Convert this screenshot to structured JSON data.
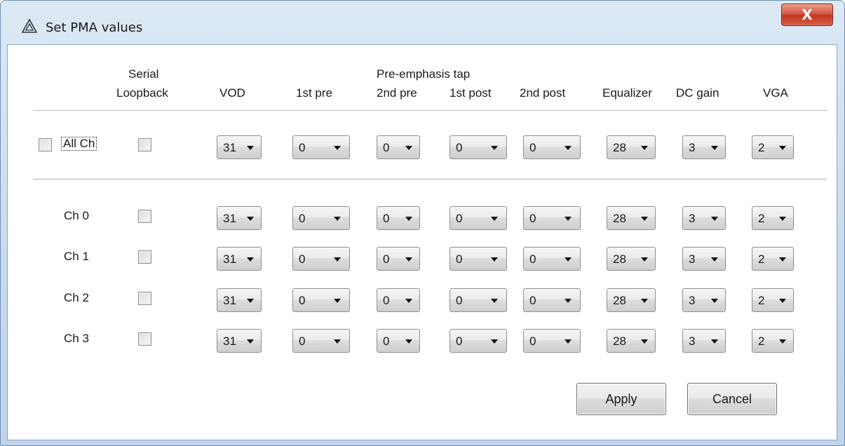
{
  "window": {
    "title": "Set PMA values",
    "close_label": "X"
  },
  "headers": {
    "serial": "Serial",
    "loopback": "Loopback",
    "vod": "VOD",
    "pre_emphasis_tap": "Pre-emphasis tap",
    "first_pre": "1st pre",
    "second_pre": "2nd pre",
    "first_post": "1st post",
    "second_post": "2nd post",
    "equalizer": "Equalizer",
    "dc_gain": "DC gain",
    "vga": "VGA"
  },
  "rows": [
    {
      "label": "All Ch",
      "checked": false,
      "loopback": false,
      "values": [
        "31",
        "0",
        "0",
        "0",
        "0",
        "28",
        "3",
        "2"
      ]
    },
    {
      "label": "Ch 0",
      "loopback": false,
      "values": [
        "31",
        "0",
        "0",
        "0",
        "0",
        "28",
        "3",
        "2"
      ]
    },
    {
      "label": "Ch 1",
      "loopback": false,
      "values": [
        "31",
        "0",
        "0",
        "0",
        "0",
        "28",
        "3",
        "2"
      ]
    },
    {
      "label": "Ch 2",
      "loopback": false,
      "values": [
        "31",
        "0",
        "0",
        "0",
        "0",
        "28",
        "3",
        "2"
      ]
    },
    {
      "label": "Ch 3",
      "loopback": false,
      "values": [
        "31",
        "0",
        "0",
        "0",
        "0",
        "28",
        "3",
        "2"
      ]
    }
  ],
  "buttons": {
    "apply": "Apply",
    "cancel": "Cancel"
  }
}
